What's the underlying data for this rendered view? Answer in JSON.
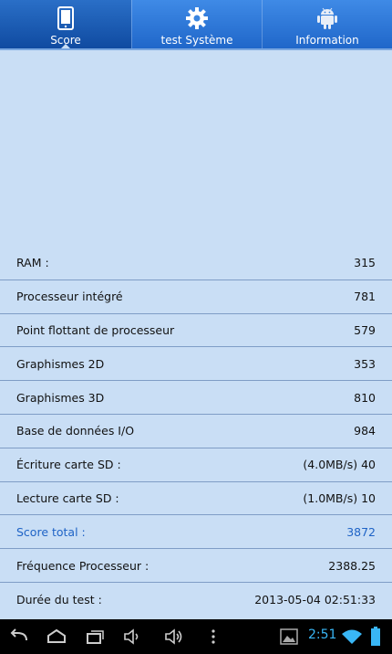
{
  "tabs": [
    {
      "label": "Score",
      "icon": "phone-icon"
    },
    {
      "label": "test Système",
      "icon": "gear-icon"
    },
    {
      "label": "Information",
      "icon": "android-icon"
    }
  ],
  "rows": [
    {
      "label": "RAM :",
      "value": "315"
    },
    {
      "label": "Processeur intégré",
      "value": "781"
    },
    {
      "label": "Point flottant de processeur",
      "value": "579"
    },
    {
      "label": "Graphismes 2D",
      "value": "353"
    },
    {
      "label": "Graphismes 3D",
      "value": "810"
    },
    {
      "label": "Base de données I/O",
      "value": "984"
    },
    {
      "label": "Écriture carte SD :",
      "value": "(4.0MB/s) 40"
    },
    {
      "label": "Lecture carte SD :",
      "value": "(1.0MB/s) 10"
    },
    {
      "label": "Score total :",
      "value": "3872"
    },
    {
      "label": "Fréquence Processeur :",
      "value": "2388.25"
    },
    {
      "label": "Durée du test :",
      "value": "2013-05-04 02:51:33"
    }
  ],
  "status": {
    "time": "2:51"
  },
  "colors": {
    "tab_active": "#1557b0",
    "tab_bar": "#3a85e0",
    "background": "#c9def5",
    "highlight": "#1e63c6",
    "clock": "#39b6f5"
  }
}
